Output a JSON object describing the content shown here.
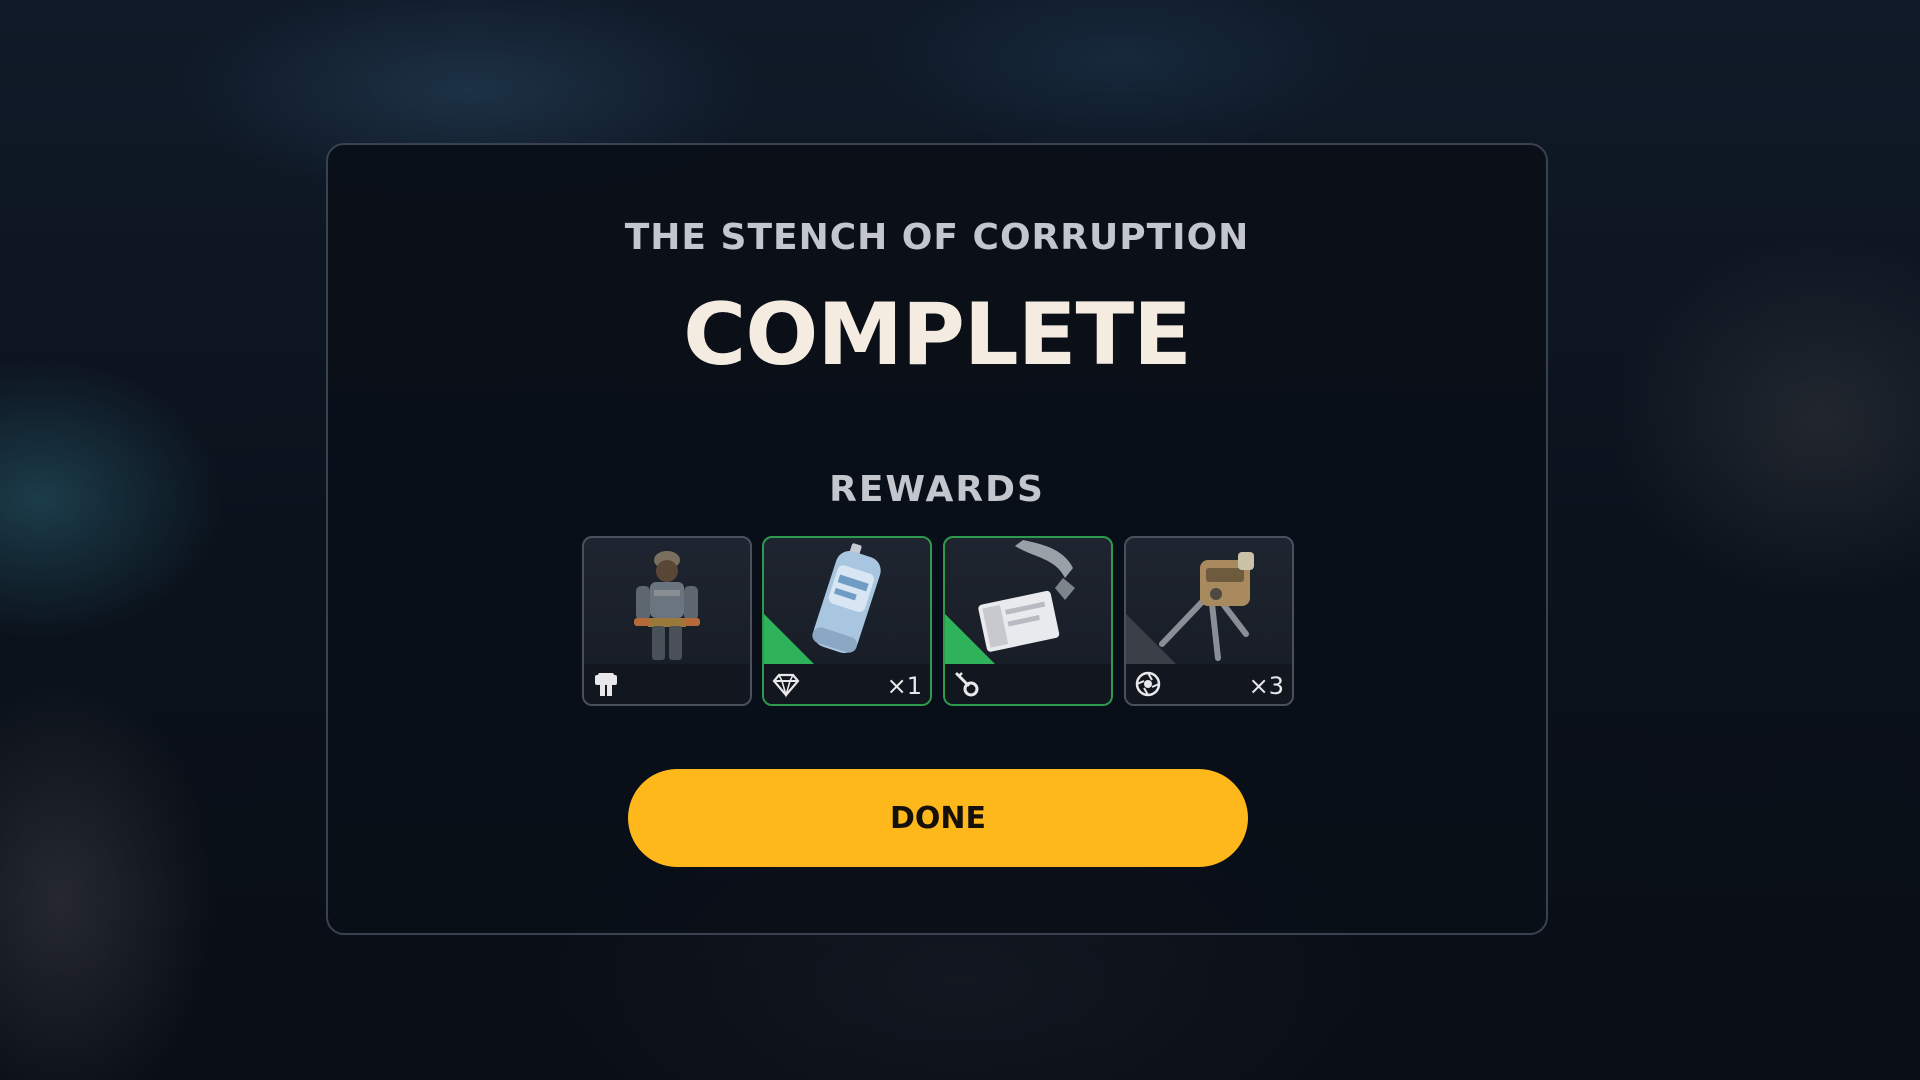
{
  "quest": {
    "title": "THE STENCH OF CORRUPTION",
    "status": "COMPLETE"
  },
  "rewards": {
    "label": "REWARDS",
    "items": [
      {
        "name": "character-outfit",
        "type_icon": "outfit-icon",
        "quantity": "",
        "rarity": "common"
      },
      {
        "name": "spray-canister",
        "type_icon": "gem-icon",
        "quantity": "×1",
        "rarity": "uncommon"
      },
      {
        "name": "id-keycard",
        "type_icon": "key-icon",
        "quantity": "",
        "rarity": "uncommon"
      },
      {
        "name": "turret-deployable",
        "type_icon": "gear-icon",
        "quantity": "×3",
        "rarity": "common"
      }
    ]
  },
  "actions": {
    "done_label": "DONE"
  },
  "colors": {
    "accent": "#ffb81c",
    "uncommon": "#2fb35a",
    "panel_border": "#3a4150",
    "title_text": "#f4ece0"
  }
}
